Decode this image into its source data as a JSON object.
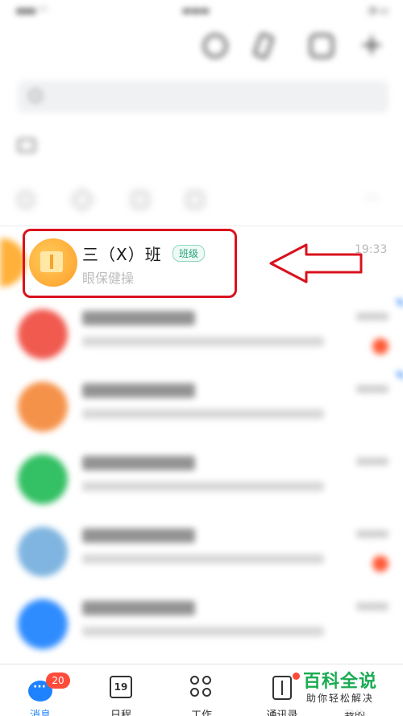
{
  "status_bar": {
    "left": "",
    "time": "",
    "right": ""
  },
  "header": {
    "org_name": "",
    "org_sub": ""
  },
  "search": {
    "placeholder": ""
  },
  "desktop_login": {
    "text": ""
  },
  "highlighted_conversation": {
    "name": "三（X）班",
    "tag": "班级",
    "message": "眼保健操",
    "time": "19:33"
  },
  "blurred_conversations": [
    {
      "avatar_color": "#f05a4f",
      "unread": true,
      "corner": true
    },
    {
      "avatar_color": "#f5924a",
      "unread": false,
      "corner": true
    },
    {
      "avatar_color": "#34c064",
      "unread": false,
      "corner": false
    },
    {
      "avatar_color": "#7fb5e0",
      "unread": true,
      "corner": false
    },
    {
      "avatar_color": "#2f8cff",
      "unread": false,
      "corner": false
    }
  ],
  "bottom_nav": [
    {
      "label": "消息",
      "icon": "chat-bubble-icon",
      "active": true,
      "badge": "20"
    },
    {
      "label": "日程",
      "icon": "calendar-icon",
      "active": false,
      "calendar_day": "19"
    },
    {
      "label": "工作",
      "icon": "work-grid-icon",
      "active": false
    },
    {
      "label": "通讯录",
      "icon": "contacts-book-icon",
      "active": false,
      "dot": true
    },
    {
      "label": "我的",
      "icon": "profile-icon",
      "active": false
    }
  ],
  "watermark": {
    "title": "百科全说",
    "subtitle": "助你轻松解决"
  },
  "colors": {
    "accent_blue": "#1e82ff",
    "highlight_red": "#d9121e",
    "tag_green": "#2aa37a",
    "badge_red": "#ff4b3a",
    "watermark_green": "#1aab53"
  }
}
